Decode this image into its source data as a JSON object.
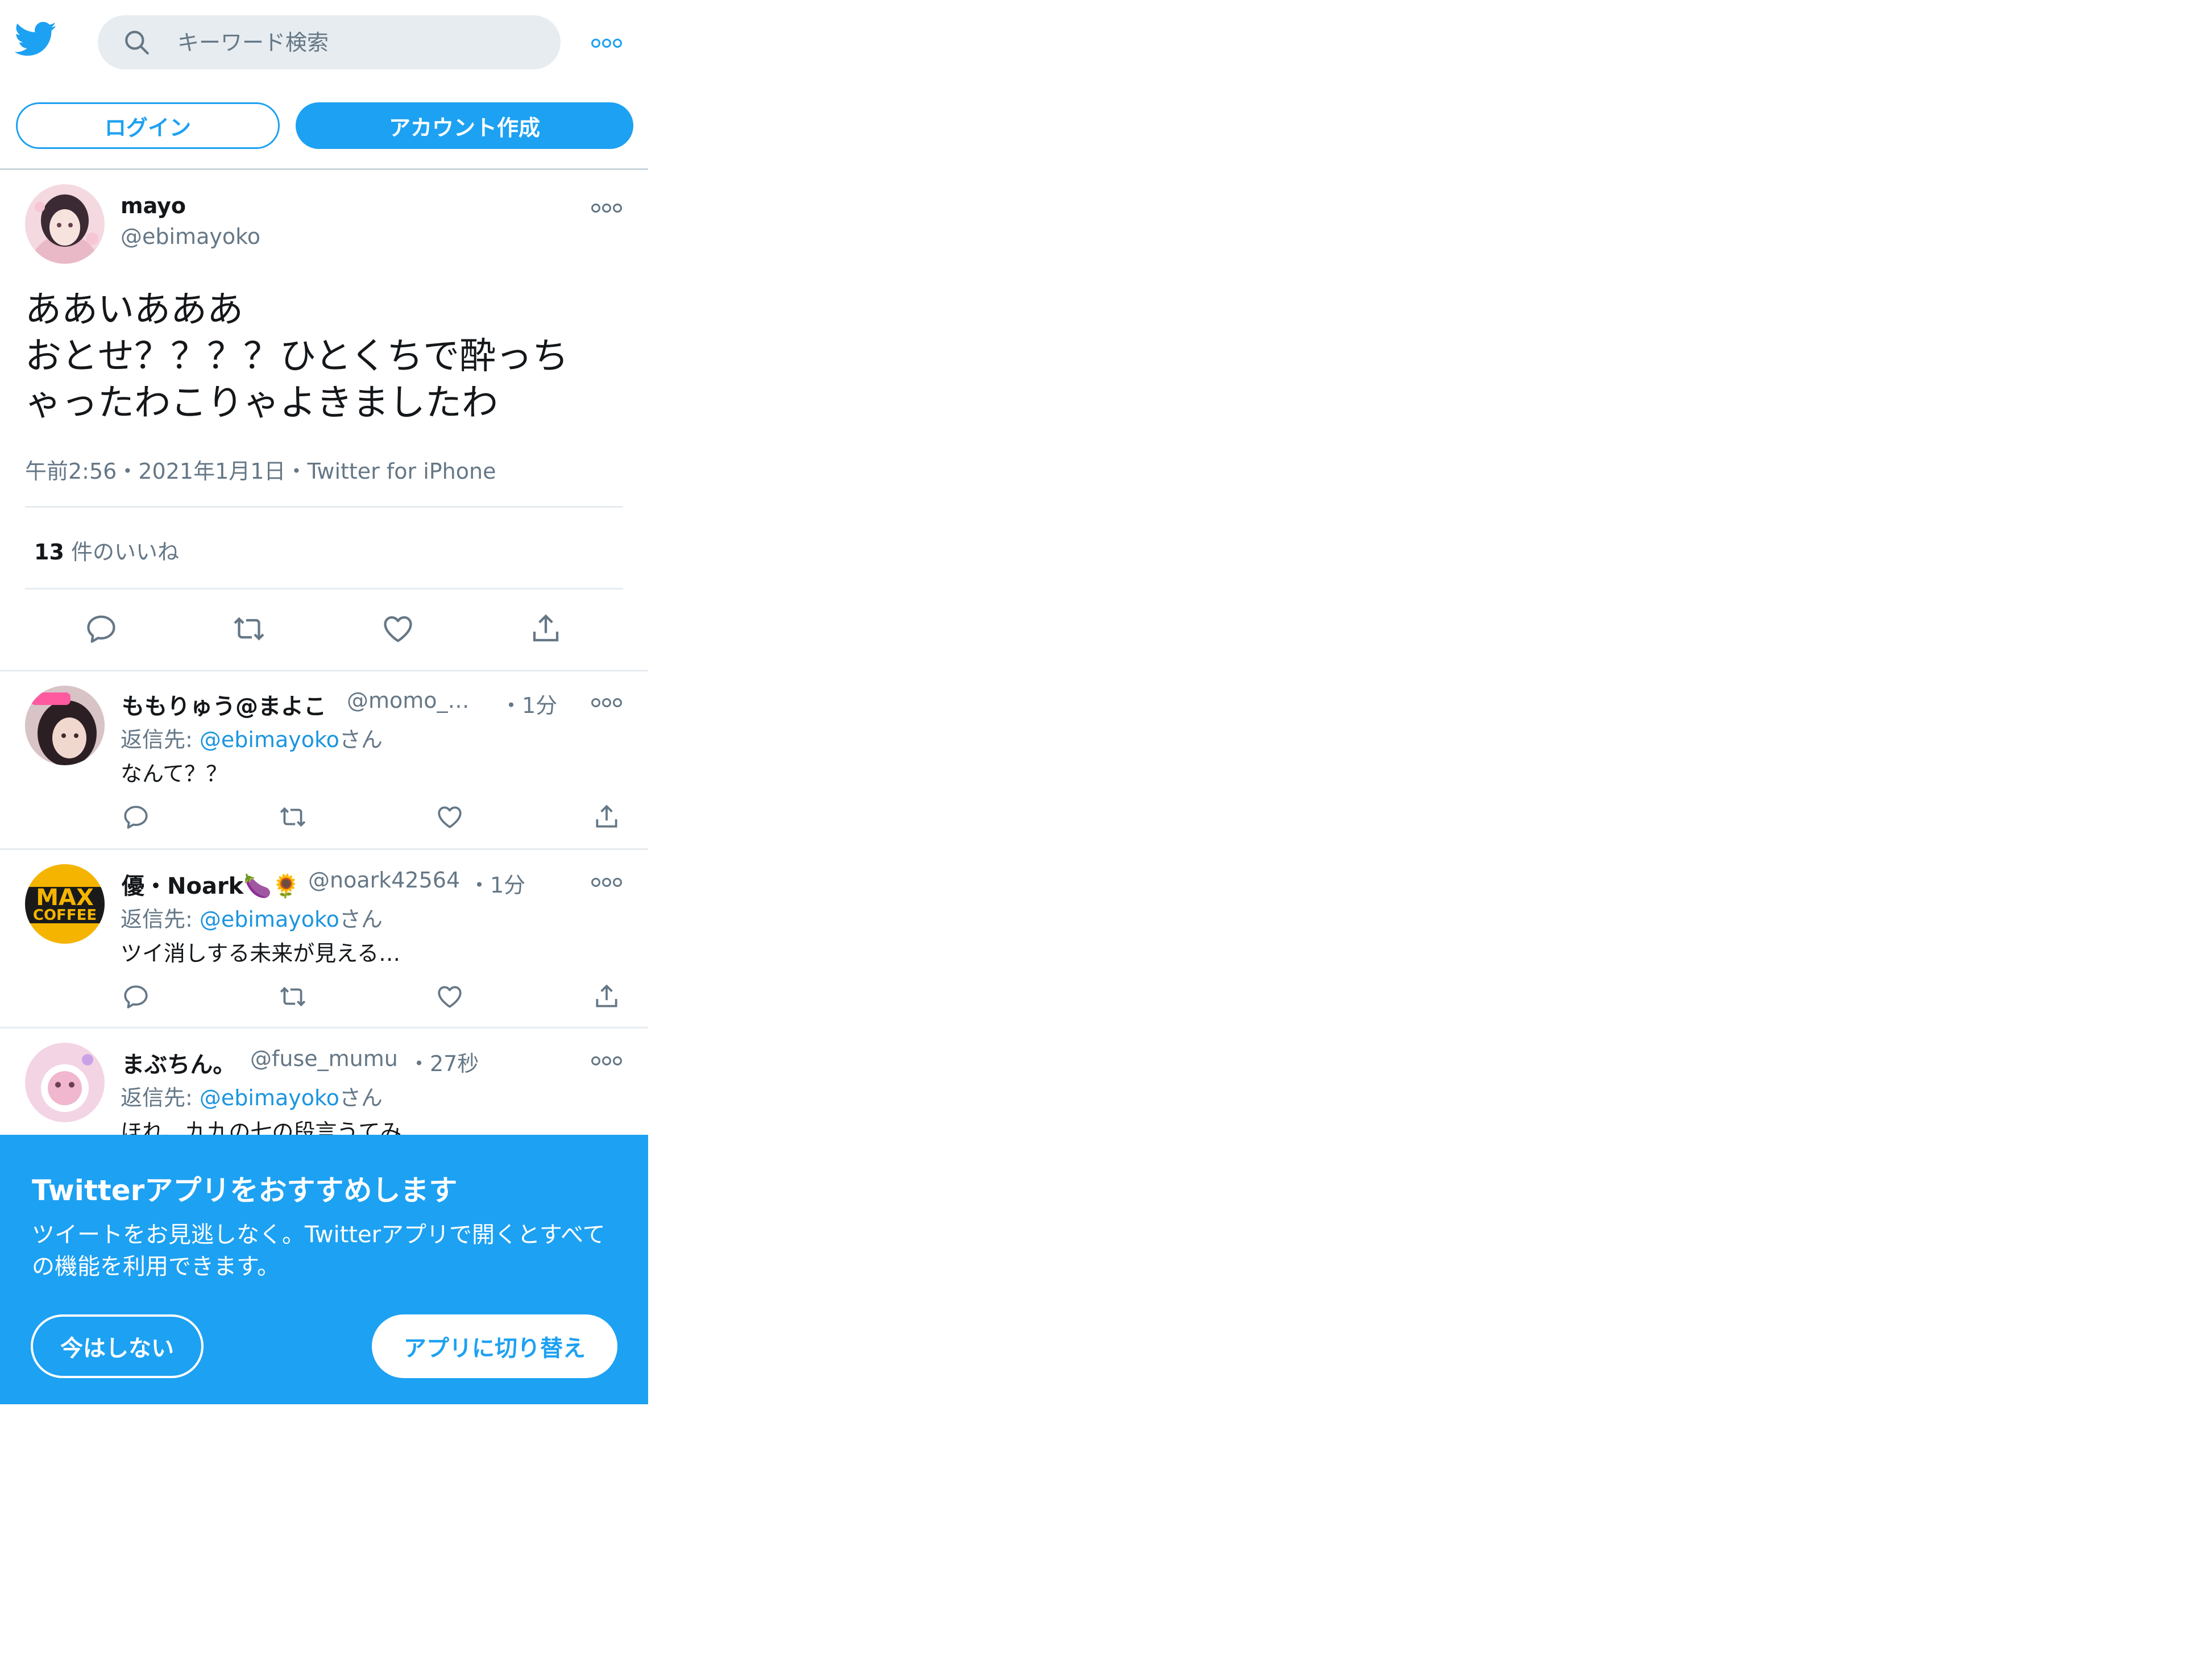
{
  "header": {
    "logo_icon": "twitter-bird-icon",
    "search_placeholder": "キーワード検索",
    "search_icon": "search-icon",
    "more_icon": "more-icon"
  },
  "auth": {
    "login_label": "ログイン",
    "signup_label": "アカウント作成"
  },
  "tweet": {
    "name": "mayo",
    "handle": "@ebimayoko",
    "text_lines": [
      "ああいあああ",
      "おとせ？？？？ひとくちで酔っち",
      "ゃったわこりゃよきましたわ"
    ],
    "time": "午前2:56",
    "date": "2021年1月1日",
    "source": "Twitter for iPhone",
    "separator": "・",
    "like_count": "13",
    "like_label": "件のいいね"
  },
  "reply_prefix": "返信先: ",
  "reply_suffix": "さん",
  "replies": [
    {
      "name": "ももりゅう@まよこ",
      "handle": "@momo_…",
      "time": "・1分",
      "reply_to": "@ebimayoko",
      "text": "なんて？？"
    },
    {
      "name": "優・Noark🍆🌻",
      "handle": "@noark42564",
      "time": "・1分",
      "reply_to": "@ebimayoko",
      "text": "ツイ消しする未来が見える…"
    },
    {
      "name": "まぶちん。",
      "handle": "@fuse_mumu",
      "time": "・27秒",
      "reply_to": "@ebimayoko",
      "text": "ほれ、九九の七の段言うてみ"
    }
  ],
  "banner": {
    "title": "Twitterアプリをおすすめします",
    "description": "ツイートをお見逃しなく。Twitterアプリで開くとすべての機能を利用できます。",
    "not_now_label": "今はしない",
    "switch_label": "アプリに切り替え"
  },
  "colors": {
    "brand": "#1da1f2",
    "link": "#1b95e0",
    "secondary_text": "#657786",
    "divider": "#e6ecf0"
  }
}
